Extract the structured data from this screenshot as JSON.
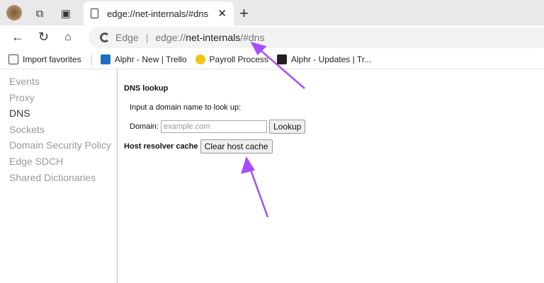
{
  "tab": {
    "title": "edge://net-internals/#dns"
  },
  "address": {
    "brand": "Edge",
    "prefix": "edge://",
    "host": "net-internals",
    "suffix": "/#dns"
  },
  "bookmarks": [
    {
      "label": "Import favorites"
    },
    {
      "label": "Alphr - New | Trello"
    },
    {
      "label": "Payroll Process"
    },
    {
      "label": "Alphr - Updates | Tr..."
    }
  ],
  "sidebar": {
    "items": [
      "Events",
      "Proxy",
      "DNS",
      "Sockets",
      "Domain Security Policy",
      "Edge SDCH",
      "Shared Dictionaries"
    ],
    "active": "DNS"
  },
  "dns": {
    "heading": "DNS lookup",
    "prompt": "Input a domain name to look up:",
    "domain_label": "Domain:",
    "placeholder": "example.com",
    "lookup_label": "Lookup",
    "cache_label": "Host resolver cache",
    "clear_label": "Clear host cache"
  },
  "colors": {
    "annotation": "#a64dff"
  }
}
